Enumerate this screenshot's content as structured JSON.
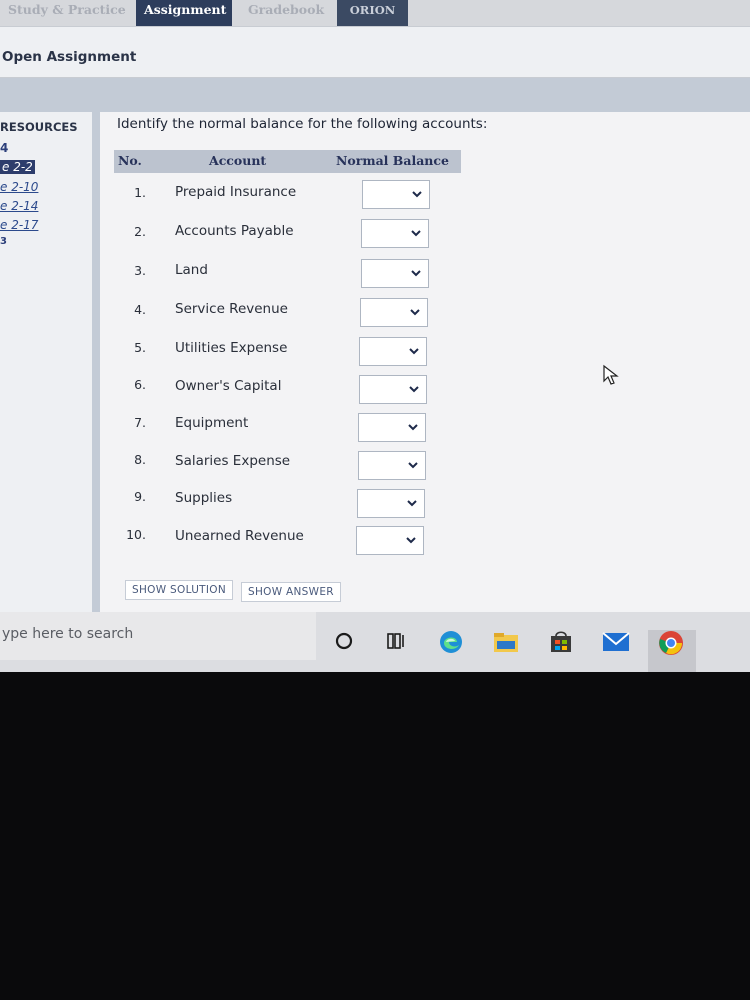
{
  "nav": {
    "tabs": [
      {
        "label": "Study & Practice"
      },
      {
        "label": "Assignment"
      },
      {
        "label": "Gradebook"
      },
      {
        "label": "ORION"
      }
    ]
  },
  "page": {
    "title": "Open Assignment"
  },
  "resources": {
    "title": "RESOURCES",
    "items": [
      {
        "label": "4"
      },
      {
        "label": "e 2-2"
      },
      {
        "label": "e 2-10"
      },
      {
        "label": "e 2-14"
      },
      {
        "label": "e 2-17"
      },
      {
        "label": "3"
      }
    ]
  },
  "question": {
    "instructions": "Identify the normal balance for the following accounts:",
    "headers": {
      "no": "No.",
      "account": "Account",
      "balance": "Normal Balance"
    },
    "rows": [
      {
        "no": "1.",
        "account": "Prepaid Insurance"
      },
      {
        "no": "2.",
        "account": "Accounts Payable"
      },
      {
        "no": "3.",
        "account": "Land"
      },
      {
        "no": "4.",
        "account": "Service Revenue"
      },
      {
        "no": "5.",
        "account": "Utilities Expense"
      },
      {
        "no": "6.",
        "account": "Owner's Capital"
      },
      {
        "no": "7.",
        "account": "Equipment"
      },
      {
        "no": "8.",
        "account": "Salaries Expense"
      },
      {
        "no": "9.",
        "account": "Supplies"
      },
      {
        "no": "10.",
        "account": "Unearned Revenue"
      }
    ]
  },
  "buttons": {
    "show_solution": "SHOW SOLUTION",
    "show_answer": "SHOW ANSWER"
  },
  "taskbar": {
    "search_placeholder": "ype here to search",
    "icons": [
      "cortana-icon",
      "task-view-icon",
      "edge-icon",
      "file-explorer-icon",
      "store-icon",
      "mail-icon",
      "chrome-icon"
    ]
  }
}
